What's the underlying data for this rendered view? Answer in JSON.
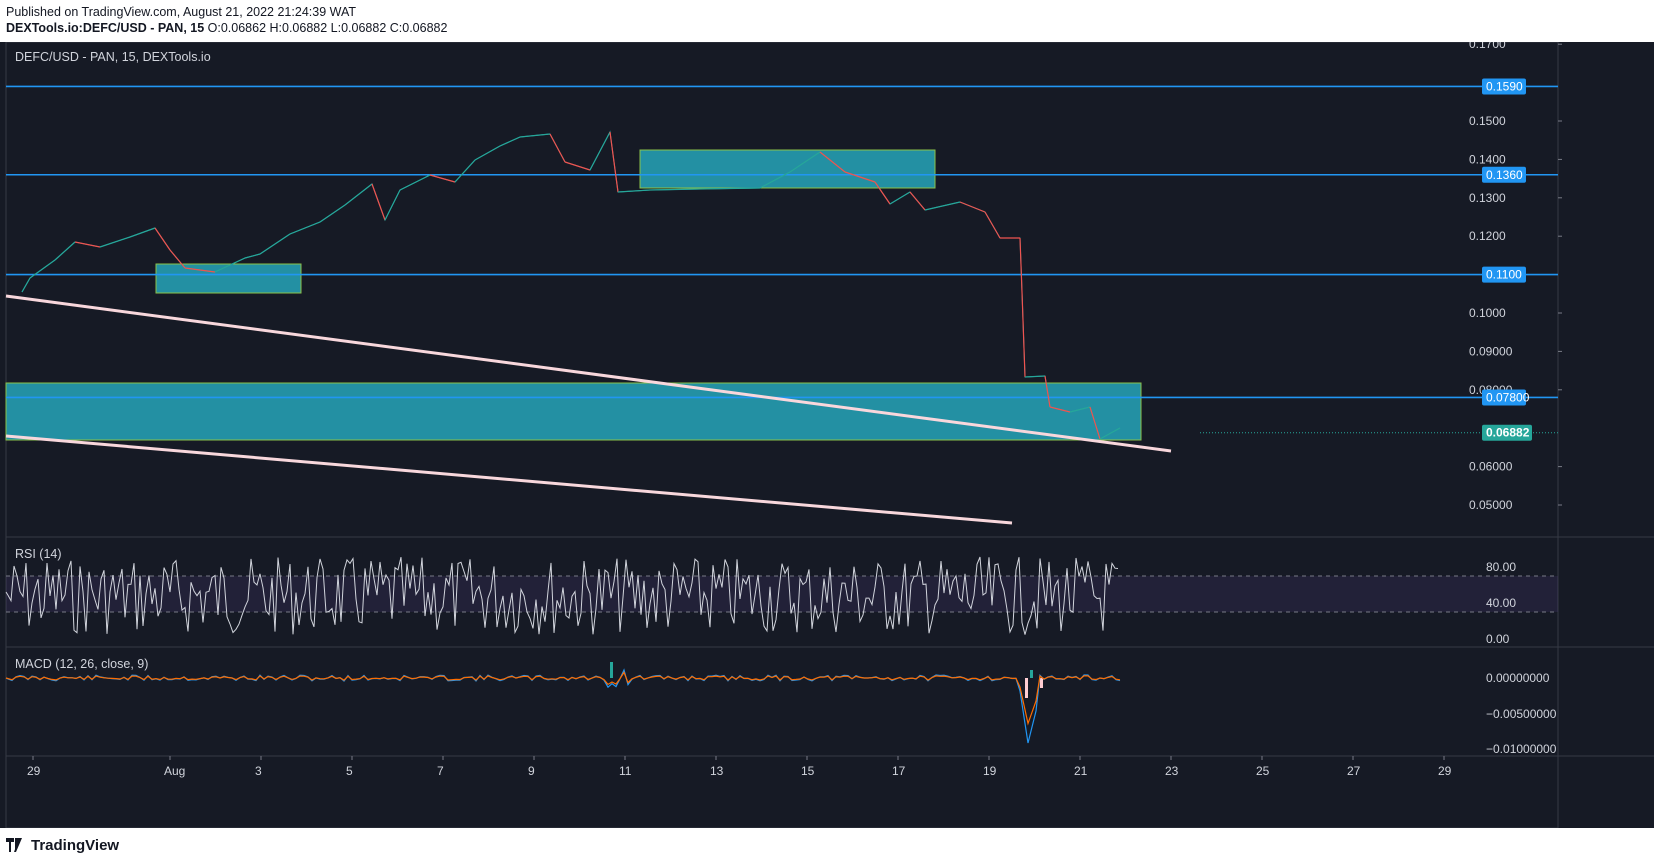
{
  "header": {
    "published": "Published on TradingView.com, August 21, 2022 21:24:39 WAT",
    "symbol_line": "DEXTools.io:DEFC/USD - PAN, 15",
    "ohlc": "O:0.06862 H:0.06882 L:0.06882 C:0.06882"
  },
  "chart": {
    "legend": "DEFC/USD - PAN, 15, DEXTools.io",
    "price_scale": [
      "0.1700",
      "0.1500",
      "0.1400",
      "0.1300",
      "0.1200",
      "0.1000",
      "0.09000",
      "0.08000",
      "0.06000",
      "0.05000"
    ],
    "price_badges": [
      {
        "label": "0.1590",
        "value": 0.159
      },
      {
        "label": "0.1360",
        "value": 0.136
      },
      {
        "label": "0.1100",
        "value": 0.11
      },
      {
        "label": "0.07800",
        "value": 0.078
      }
    ],
    "current_price": "0.06882",
    "dates": [
      "29",
      "Aug",
      "3",
      "5",
      "7",
      "9",
      "11",
      "13",
      "15",
      "17",
      "19",
      "21",
      "23",
      "25",
      "27",
      "29"
    ]
  },
  "rsi": {
    "label": "RSI (14)",
    "scale": [
      "80.00",
      "40.00",
      "0.00"
    ]
  },
  "macd": {
    "label": "MACD (12, 26, close, 9)",
    "scale": [
      "0.00000000",
      "−0.00500000",
      "−0.01000000"
    ]
  },
  "footer": {
    "brand": "TradingView"
  },
  "colors": {
    "background": "#161a25",
    "level_line": "#2196f3",
    "zone_fill": "#26a6ba",
    "trendline": "#f8d7dc",
    "badge_bg": "#2196f3",
    "current_badge_bg": "#26a69a",
    "up_candle": "#26a69a",
    "down_candle": "#ef5350"
  }
}
